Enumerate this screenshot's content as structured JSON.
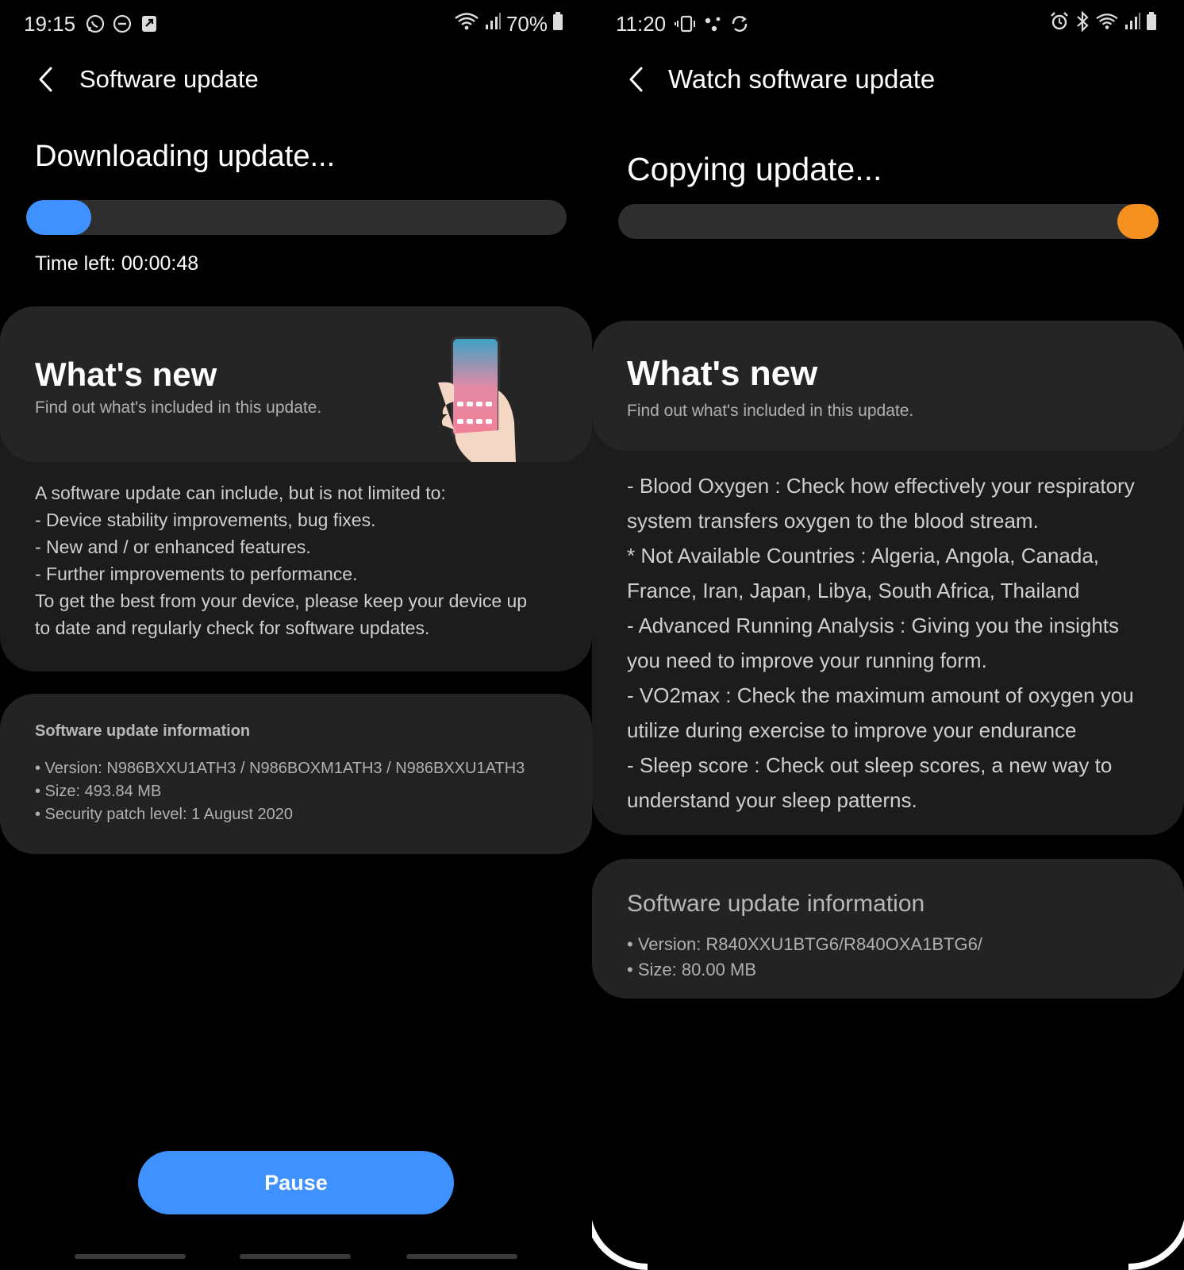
{
  "left": {
    "status": {
      "time": "19:15",
      "battery": "70%"
    },
    "appbar": {
      "title": "Software update"
    },
    "heading": "Downloading update...",
    "progress": {
      "percent": 12,
      "color": "#3e91ff"
    },
    "time_left": "Time left: 00:00:48",
    "whats_new": {
      "title": "What's new",
      "subtitle": "Find out what's included in this update.",
      "lines": [
        "A software update can include, but is not limited to:",
        " - Device stability improvements, bug fixes.",
        " - New and / or enhanced features.",
        " - Further improvements to performance.",
        "To get the best from your device, please keep your device up",
        "to date and regularly check for software updates."
      ]
    },
    "info": {
      "title": "Software update information",
      "items": [
        "• Version: N986BXXU1ATH3 / N986BOXM1ATH3 / N986BXXU1ATH3",
        "• Size: 493.84 MB",
        "• Security patch level: 1 August 2020"
      ]
    },
    "pause_label": "Pause"
  },
  "right": {
    "status": {
      "time": "11:20"
    },
    "appbar": {
      "title": "Watch software update"
    },
    "heading": "Copying update...",
    "progress": {
      "percent": 100,
      "color": "#f3901f"
    },
    "whats_new": {
      "title": "What's new",
      "subtitle": "Find out what's included in this update.",
      "lines": [
        "- Blood Oxygen : Check how effectively your respiratory",
        "system transfers oxygen to the blood stream.",
        "  * Not Available Countries : Algeria, Angola, Canada,",
        "France, Iran, Japan, Libya, South Africa, Thailand",
        "- Advanced Running Analysis : Giving you the insights",
        "you need to improve your running form.",
        "- VO2max : Check the maximum amount of oxygen you",
        "utilize during exercise to improve your endurance",
        "- Sleep score : Check out sleep scores, a new way to",
        "understand your sleep patterns."
      ]
    },
    "info": {
      "title": "Software update information",
      "items": [
        "• Version: R840XXU1BTG6/R840OXA1BTG6/",
        "• Size: 80.00 MB"
      ]
    }
  },
  "colors": {
    "accent_blue": "#3e91ff",
    "accent_orange": "#f3901f",
    "card": "#1c1c1c"
  },
  "icons": [
    "whatsapp-icon",
    "dnd-icon",
    "app-notification-icon",
    "wifi-icon",
    "signal-icon",
    "battery-icon",
    "back-arrow-icon",
    "alarm-icon",
    "bluetooth-icon",
    "vibrate-icon",
    "sync-icon"
  ]
}
